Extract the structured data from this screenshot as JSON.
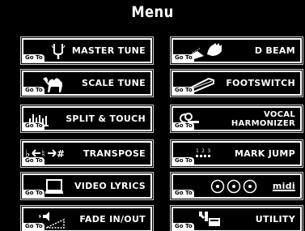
{
  "title": "Menu",
  "goto_label": "Go To",
  "buttons": {
    "master_tune": "MASTER TUNE",
    "d_beam": "D BEAM",
    "scale_tune": "SCALE TUNE",
    "footswitch": "FOOTSWITCH",
    "split_touch": "SPLIT & TOUCH",
    "vocal_harmonizer_line1": "VOCAL",
    "vocal_harmonizer_line2": "HARMONIZER",
    "transpose": "TRANSPOSE",
    "mark_jump": "MARK JUMP",
    "video_lyrics": "VIDEO LYRICS",
    "midi": "midi",
    "fade_in_out": "FADE IN/OUT",
    "utility": "UTILITY"
  },
  "icons": {
    "master_tune": "tuning-fork-icon",
    "d_beam": "hand-beam-icon",
    "scale_tune": "camel-icon",
    "footswitch": "pedal-icon",
    "split_touch": "keyboard-split-icon",
    "vocal_harmonizer": "microphone-icon",
    "transpose": "transpose-arrows-icon",
    "mark_jump": "mark-numbers-icon",
    "video_lyrics": "monitor-icon",
    "disks": "three-disks-icon",
    "fade_in_out": "fade-speaker-icon",
    "utility": "tools-icon"
  }
}
